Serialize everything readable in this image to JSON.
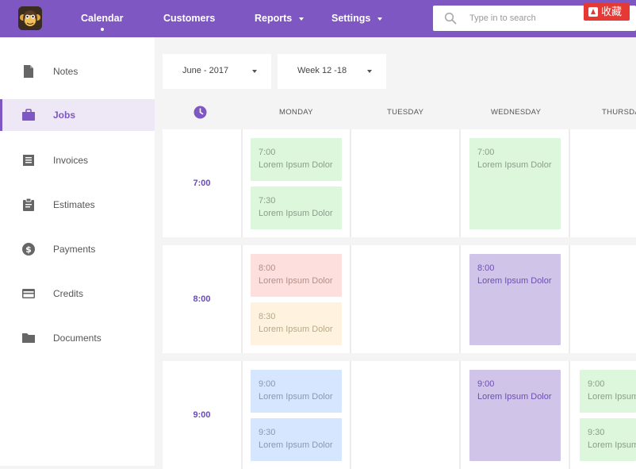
{
  "header": {
    "nav": [
      {
        "label": "Calendar",
        "active": true
      },
      {
        "label": "Customers"
      },
      {
        "label": "Reports",
        "has_menu": true
      },
      {
        "label": "Settings",
        "has_menu": true
      }
    ],
    "search_placeholder": "Type in to search",
    "badge_label": "收藏"
  },
  "sidebar": {
    "items": [
      {
        "label": "Notes",
        "icon": "file-icon"
      },
      {
        "label": "Jobs",
        "icon": "briefcase-icon",
        "active": true
      },
      {
        "label": "Invoices",
        "icon": "receipt-icon"
      },
      {
        "label": "Estimates",
        "icon": "clipboard-icon"
      },
      {
        "label": "Payments",
        "icon": "dollar-circle-icon"
      },
      {
        "label": "Credits",
        "icon": "credit-card-icon"
      },
      {
        "label": "Documents",
        "icon": "folder-icon"
      }
    ]
  },
  "filters": {
    "month": "June - 2017",
    "week": "Week 12 -18"
  },
  "days": [
    "MONDAY",
    "TUESDAY",
    "WEDNESDAY",
    "THURSDAY"
  ],
  "times": [
    "7:00",
    "8:00",
    "9:00"
  ],
  "events": {
    "r0_mon_a": {
      "time": "7:00",
      "text": "Lorem Ipsum Dolor",
      "color": "green"
    },
    "r0_mon_b": {
      "time": "7:30",
      "text": "Lorem Ipsum Dolor",
      "color": "green"
    },
    "r0_wed": {
      "time": "7:00",
      "text": "Lorem Ipsum Dolor",
      "color": "green"
    },
    "r1_mon_a": {
      "time": "8:00",
      "text": "Lorem Ipsum Dolor",
      "color": "pink"
    },
    "r1_mon_b": {
      "time": "8:30",
      "text": "Lorem Ipsum Dolor",
      "color": "yellow"
    },
    "r1_wed": {
      "time": "8:00",
      "text": "Lorem Ipsum Dolor",
      "color": "purple"
    },
    "r2_mon_a": {
      "time": "9:00",
      "text": "Lorem Ipsum Dolor",
      "color": "blue"
    },
    "r2_mon_b": {
      "time": "9:30",
      "text": "Lorem Ipsum Dolor",
      "color": "blue"
    },
    "r2_wed": {
      "time": "9:00",
      "text": "Lorem Ipsum Dolor",
      "color": "purple"
    },
    "r2_thu_a": {
      "time": "9:00",
      "text": "Lorem Ipsum",
      "color": "green"
    },
    "r2_thu_b": {
      "time": "9:30",
      "text": "Lorem Ipsum",
      "color": "green"
    }
  },
  "colors": {
    "brand": "#7e57c2",
    "accent_text": "#6a4ab8"
  }
}
